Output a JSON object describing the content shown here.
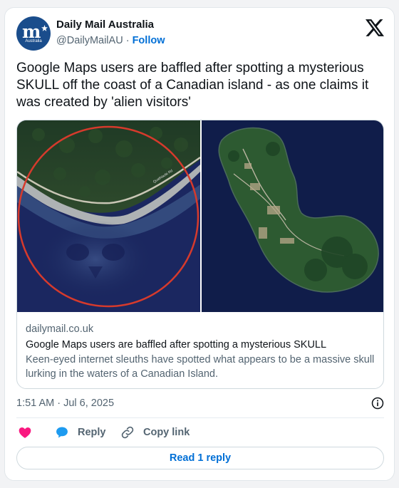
{
  "account": {
    "display_name": "Daily Mail Australia",
    "handle": "@DailyMailAU",
    "separator": " · ",
    "follow_label": "Follow",
    "avatar_monogram": "m",
    "avatar_caption": "Australia",
    "avatar_color": "#1a4d8c"
  },
  "tweet": {
    "text": "Google Maps users are baffled after spotting a mysterious SKULL off the coast of a Canadian island - as one claims it was created by 'alien visitors'"
  },
  "media": {
    "images": [
      {
        "name": "skull-shape-satellite-image",
        "highlight": "red-circle"
      },
      {
        "name": "island-satellite-image"
      }
    ],
    "road_label": "Quathiaski Rd"
  },
  "link_card": {
    "domain": "dailymail.co.uk",
    "title": "Google Maps users are baffled after spotting a mysterious SKULL",
    "description": "Keen-eyed internet sleuths have spotted what appears to be a massive skull lurking in the waters of a Canadian Island."
  },
  "meta": {
    "timestamp": "1:51 AM · Jul 6, 2025"
  },
  "actions": {
    "reply_label": "Reply",
    "copy_link_label": "Copy link",
    "read_replies_label": "Read 1 reply"
  },
  "icons": {
    "logo": "x-logo-icon",
    "info": "info-icon",
    "like": "heart-icon",
    "reply": "speech-bubble-icon",
    "copy": "link-icon"
  },
  "colors": {
    "accent": "#006fd6",
    "like": "#f91880",
    "reply": "#1d9bf0",
    "text": "#0f1419",
    "muted": "#536471"
  }
}
